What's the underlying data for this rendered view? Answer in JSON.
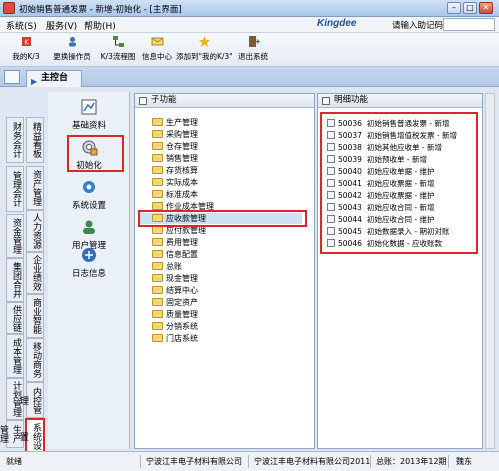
{
  "window": {
    "title": "初始销售普通发票 - 新增-初始化 - [主界面]"
  },
  "menubar": {
    "items": [
      "系统(S)",
      "服务(V)",
      "帮助(H)"
    ],
    "brand": "Kingdee",
    "assist_label": "请输入助记码",
    "assist_value": ""
  },
  "toolbar": {
    "buttons": [
      {
        "label": "我的K/3",
        "icon": "k3-icon"
      },
      {
        "label": "更换操作员",
        "icon": "change-user-icon"
      },
      {
        "label": "K/3流程图",
        "icon": "flowchart-icon"
      },
      {
        "label": "信息中心",
        "icon": "message-icon"
      },
      {
        "label": "添加到\"我的K/3\"",
        "icon": "add-favorite-icon"
      },
      {
        "label": "退出系统",
        "icon": "exit-icon"
      }
    ]
  },
  "tabs": {
    "main": "主控台"
  },
  "left_strip": {
    "col1": [
      "财务会计",
      "管理会计",
      "资金管理",
      "集团合并",
      "供应链",
      "成本管理",
      "计划管理",
      "生产管理"
    ],
    "col2": [
      "精益看板",
      "资产管理",
      "人力资源",
      "企业绩效",
      "商业智能",
      "移动商务",
      "内控管理",
      "系统设置"
    ],
    "active": "系统设置"
  },
  "icon_panel": {
    "items": [
      {
        "label": "基础资料",
        "icon": "base-data-icon"
      },
      {
        "label": "初始化",
        "icon": "initialize-icon"
      },
      {
        "label": "系统设置",
        "icon": "settings-icon"
      },
      {
        "label": "用户管理",
        "icon": "users-icon"
      },
      {
        "label": "日志信息",
        "icon": "log-icon"
      }
    ],
    "active": "初始化"
  },
  "sub_panel": {
    "header": "子功能",
    "items": [
      "生产管理",
      "采购管理",
      "仓存管理",
      "销售管理",
      "存货核算",
      "实际成本",
      "标准成本",
      "作业成本管理",
      "应收款管理",
      "应付款管理",
      "费用管理",
      "信息配置",
      "总账",
      "现金管理",
      "结算中心",
      "固定资产",
      "质量管理",
      "分销系统",
      "门店系统"
    ],
    "selected": "应收款管理"
  },
  "detail_panel": {
    "header": "明细功能",
    "rows": [
      {
        "code": "50036",
        "text": "初始销售普通发票 - 新增"
      },
      {
        "code": "50037",
        "text": "初始销售增值税发票 - 新增"
      },
      {
        "code": "50038",
        "text": "初始其他应收单 - 新增"
      },
      {
        "code": "50039",
        "text": "初始预收单 - 新增"
      },
      {
        "code": "50040",
        "text": "初始应收单据 - 维护"
      },
      {
        "code": "50041",
        "text": "初始应收票据 - 新增"
      },
      {
        "code": "50042",
        "text": "初始应收票据 - 维护"
      },
      {
        "code": "50043",
        "text": "初始应收合同 - 新增"
      },
      {
        "code": "50044",
        "text": "初始应收合同 - 维护"
      },
      {
        "code": "50045",
        "text": "初始数据录入 - 期初对账"
      },
      {
        "code": "50046",
        "text": "初始化数据 - 应收账款"
      }
    ]
  },
  "status": {
    "user": "就绪",
    "company": "宁波江丰电子材料有限公司",
    "database": "宁波江丰电子材料有限公司2011",
    "period": "总账：2013年12期",
    "operator": "魏东"
  },
  "colors": {
    "highlight": "#d42a2a",
    "accent": "#1b4f9c"
  }
}
